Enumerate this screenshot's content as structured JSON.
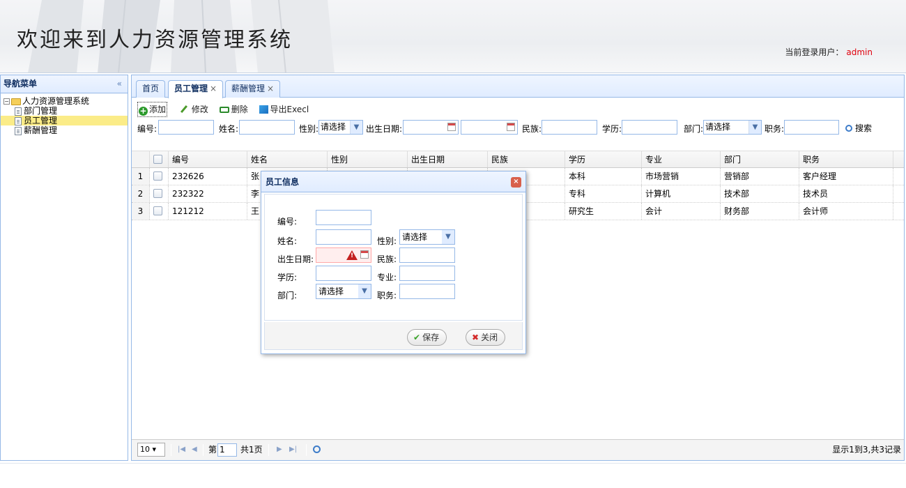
{
  "header": {
    "title": "欢迎来到人力资源管理系统",
    "user_label": "当前登录用户：",
    "user_name": "admin"
  },
  "nav": {
    "title": "导航菜单",
    "collapse": "«",
    "root": "人力资源管理系统",
    "items": [
      "部门管理",
      "员工管理",
      "薪酬管理"
    ],
    "selected": "员工管理"
  },
  "tabs": [
    {
      "label": "首页",
      "closable": false
    },
    {
      "label": "员工管理",
      "closable": true,
      "active": true
    },
    {
      "label": "薪酬管理",
      "closable": true
    }
  ],
  "toolbar": {
    "add": "添加",
    "edit": "修改",
    "delete": "删除",
    "export": "导出Execl"
  },
  "search": {
    "id_label": "编号:",
    "name_label": "姓名:",
    "gender_label": "性别:",
    "gender_value": "请选择",
    "birth_label": "出生日期:",
    "ethnic_label": "民族:",
    "edu_label": "学历:",
    "dept_label": "部门:",
    "dept_value": "请选择",
    "post_label": "职务:",
    "search_btn": "搜索"
  },
  "grid": {
    "columns": [
      "编号",
      "姓名",
      "性别",
      "出生日期",
      "民族",
      "学历",
      "专业",
      "部门",
      "职务"
    ],
    "rows": [
      {
        "num": "1",
        "id": "232626",
        "name": "张",
        "edu": "本科",
        "major": "市场营销",
        "dept": "营销部",
        "post": "客户经理"
      },
      {
        "num": "2",
        "id": "232322",
        "name": "李",
        "edu": "专科",
        "major": "计算机",
        "dept": "技术部",
        "post": "技术员"
      },
      {
        "num": "3",
        "id": "121212",
        "name": "王",
        "edu": "研究生",
        "major": "会计",
        "dept": "财务部",
        "post": "会计师"
      }
    ]
  },
  "pager": {
    "page_size": "10 ▾",
    "page_prefix": "第",
    "page_value": "1",
    "page_total": "共1页",
    "info": "显示1到3,共3记录"
  },
  "dialog": {
    "title": "员工信息",
    "close": "×",
    "id_label": "编号:",
    "name_label": "姓名:",
    "gender_label": "性别:",
    "gender_value": "请选择",
    "birth_label": "出生日期:",
    "ethnic_label": "民族:",
    "edu_label": "学历:",
    "major_label": "专业:",
    "dept_label": "部门:",
    "dept_value": "请选择",
    "post_label": "职务:",
    "save": "保存",
    "close_btn": "关闭"
  },
  "colors": {
    "border": "#95b8e7",
    "header_bg": "#e0ecff",
    "selected": "#fbec88",
    "user_name": "#e0000d"
  }
}
